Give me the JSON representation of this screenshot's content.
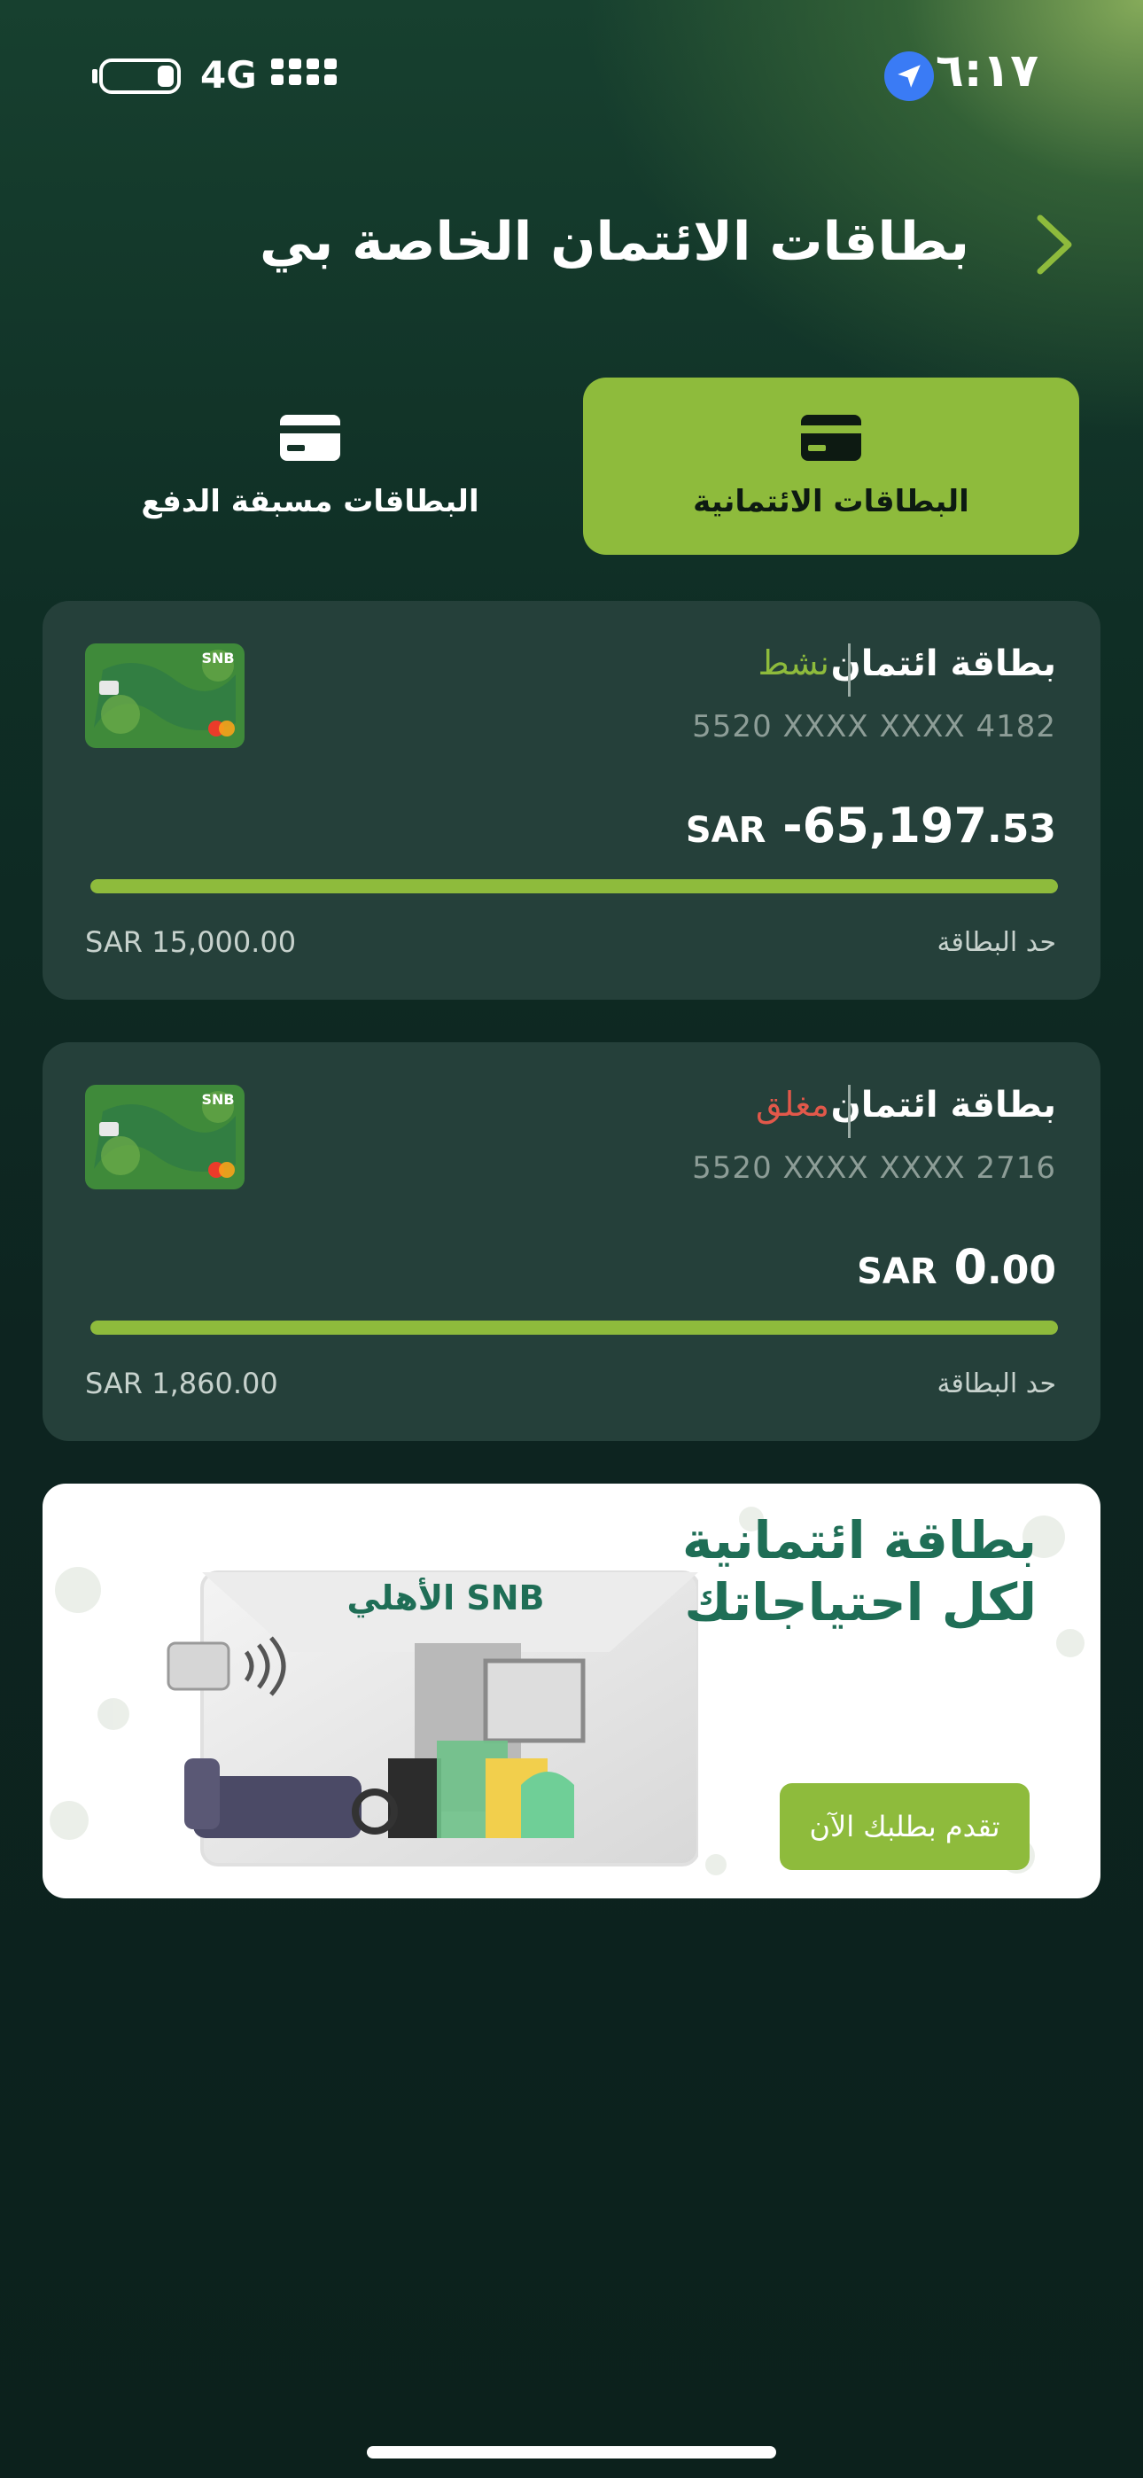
{
  "status_bar": {
    "time": "٦:١٧",
    "network": "4G",
    "icons": [
      "location-arrow-icon",
      "battery-icon",
      "signal-icon"
    ]
  },
  "header": {
    "title": "بطاقات الائتمان الخاصة بي",
    "back_icon": "chevron-right-icon"
  },
  "tabs": [
    {
      "label": "البطاقات الائتمانية",
      "icon": "credit-card-icon",
      "active": true
    },
    {
      "label": "البطاقات مسبقة الدفع",
      "icon": "credit-card-icon",
      "active": false
    }
  ],
  "cards": [
    {
      "title": "بطاقة ائتمان",
      "status": "نشط",
      "status_color": "#8ebb3c",
      "number": "5520 XXXX XXXX 4182",
      "currency": "SAR",
      "amount_int": "-65,197",
      "amount_dec": ".53",
      "limit_label": "حد البطاقة",
      "limit_value": "SAR 15,000.00",
      "progress": 1.0
    },
    {
      "title": "بطاقة ائتمان",
      "status": "مغلق",
      "status_color": "#e2584a",
      "number": "5520 XXXX XXXX 2716",
      "currency": "SAR",
      "amount_int": "0",
      "amount_dec": ".00",
      "limit_label": "حد البطاقة",
      "limit_value": "SAR 1,860.00",
      "progress": 1.0
    }
  ],
  "promo": {
    "headline_line1": "بطاقة ائتمانية",
    "headline_line2": "لكل احتياجاتك",
    "brand_logo_text": "الأهلي SNB",
    "cta_label": "تقدم بطلبك الآن"
  },
  "colors": {
    "accent": "#8ebb3c",
    "panel": "#25403a",
    "background": "#0d2420",
    "promo_text": "#1f6e56"
  }
}
